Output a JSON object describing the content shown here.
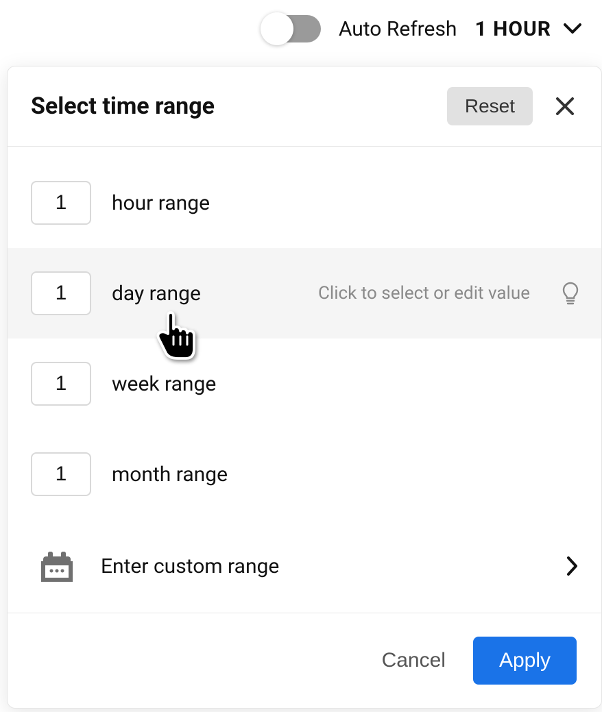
{
  "topbar": {
    "auto_refresh_label": "Auto Refresh",
    "toggle_on": false,
    "selected_value": "1 HOUR"
  },
  "panel": {
    "title": "Select time range",
    "reset_label": "Reset",
    "hint_text": "Click to select or edit value",
    "rows": [
      {
        "value": "1",
        "label": "hour range",
        "hovered": false
      },
      {
        "value": "1",
        "label": "day range",
        "hovered": true
      },
      {
        "value": "1",
        "label": "week range",
        "hovered": false
      },
      {
        "value": "1",
        "label": "month range",
        "hovered": false
      }
    ],
    "custom_label": "Enter custom range",
    "cancel_label": "Cancel",
    "apply_label": "Apply"
  }
}
